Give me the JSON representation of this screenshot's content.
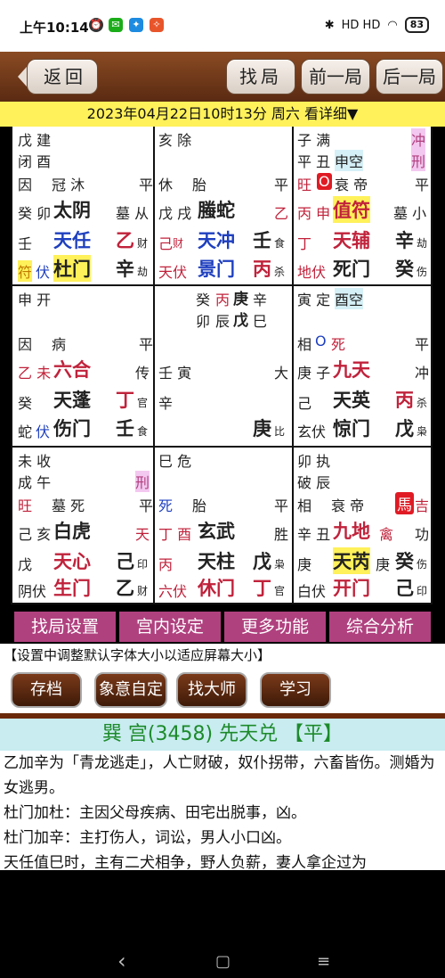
{
  "status": {
    "time": "上午10:14",
    "right": "HD HD",
    "battery": "83"
  },
  "topbar": {
    "back": "返回",
    "find": "找局",
    "prev": "前一局",
    "next": "后一局"
  },
  "date_line": "2023年04月22日10时13分 周六 看详细▼",
  "palaces": {
    "p1": {
      "l1": "戊 建",
      "l2": "闭 酉",
      "r1": "因",
      "r2": "冠 沐",
      "r3": "平",
      "r4a": "癸 卯",
      "r4b": "太阴",
      "r4c": "墓 从",
      "r5a": "壬",
      "r5b": "天任",
      "r5c": "乙",
      "r5d": "财",
      "r6a": "符",
      "r6b": "伏",
      "r6c": "杜门",
      "r6d": "辛",
      "r6e": "劫"
    },
    "p2": {
      "l1": "亥 除",
      "r1": "休",
      "r2": "胎",
      "r3": "平",
      "r4a": "戊 戌",
      "r4b": "螣蛇",
      "r4c": "乙",
      "r5a": "己",
      "r5b": "财",
      "r5c": "天冲",
      "r5d": "壬",
      "r5e": "食",
      "r6a": "天伏",
      "r6b": "景门",
      "r6c": "丙",
      "r6d": "杀"
    },
    "p3": {
      "l1": "子 满",
      "l2": "平 丑",
      "l2b": "申空",
      "tag1": "冲",
      "tag2": "刑",
      "r1a": "旺",
      "r1b": "O",
      "r1c": "衰 帝",
      "r1d": "平",
      "r4a": "丙 申",
      "r4b": "值符",
      "r4c": "墓 小",
      "r5a": "丁",
      "r5b": "天辅",
      "r5c": "辛",
      "r5d": "劫",
      "r6a": "地伏",
      "r6b": "死门",
      "r6c": "癸",
      "r6d": "伤"
    },
    "p4": {
      "l1": "申 开",
      "r1": "因",
      "r2": "病",
      "r3": "平",
      "r4a": "乙 未",
      "r4b": "六合",
      "r4c": "传",
      "r5a": "癸",
      "r5b": "天蓬",
      "r5c": "丁",
      "r5d": "官",
      "r6a": "蛇",
      "r6b": "伏",
      "r6c": "伤门",
      "r6d": "壬",
      "r6e": "食"
    },
    "p5": {
      "l1a": "癸",
      "l1b": "丙",
      "l1c": "庚",
      "l1d": "辛",
      "l2a": "卯",
      "l2b": "辰",
      "l2c": "戊",
      "l2d": "巳",
      "r1": "壬 寅",
      "r1b": "大",
      "r2": "辛",
      "r3a": "庚",
      "r3b": "比"
    },
    "p6": {
      "l1": "寅 定",
      "l1b": "酉空",
      "r1a": "相",
      "r1b": "O",
      "r1c": "死",
      "r1d": "平",
      "r4a": "庚 子",
      "r4b": "九天",
      "r4c": "冲",
      "r5a": "己",
      "r5b": "天英",
      "r5c": "丙",
      "r5d": "杀",
      "r6a": "玄伏",
      "r6b": "惊门",
      "r6c": "戊",
      "r6d": "枭"
    },
    "p7": {
      "l1": "未 收",
      "l2": "成 午",
      "tag": "刑",
      "r1a": "旺",
      "r1b": "墓 死",
      "r1c": "平",
      "r4a": "己 亥",
      "r4b": "白虎",
      "r4c": "天",
      "r5a": "戊",
      "r5b": "天心",
      "r5c": "己",
      "r5d": "印",
      "r6a": "阴伏",
      "r6b": "生门",
      "r6c": "乙",
      "r6d": "财"
    },
    "p8": {
      "l1": "巳 危",
      "r1a": "死",
      "r1b": "胎",
      "r1c": "平",
      "r4a": "丁 酉",
      "r4b": "玄武",
      "r4c": "胜",
      "r5a": "丙",
      "r5b": "天柱",
      "r5c": "戊",
      "r5d": "枭",
      "r6a": "六伏",
      "r6b": "休门",
      "r6c": "丁",
      "r6d": "官"
    },
    "p9": {
      "l1": "卯 执",
      "l2": "破 辰",
      "r1a": "相",
      "r1b": "衰 帝",
      "r1c": "馬",
      "r1d": "吉",
      "r4a": "辛 丑",
      "r4b": "九地",
      "r4c": "禽",
      "r4d": "功",
      "r5a": "庚",
      "r5b": "天芮",
      "r5c": "庚",
      "r5d": "癸",
      "r5e": "伤",
      "r6a": "白伏",
      "r6b": "开门",
      "r6c": "己",
      "r6d": "印"
    }
  },
  "purplebar": [
    "找局设置",
    "宫内设定",
    "更多功能",
    "综合分析"
  ],
  "hint": "【设置中调整默认字体大小以适应屏幕大小】",
  "buttons": [
    "存档",
    "象意自定",
    "找大师",
    "学习"
  ],
  "palace_title": "巽 宫(3458) 先天兑  【平】",
  "detail": [
    "乙加辛为「青龙逃走」，人亡财破，奴仆拐带，六畜皆伤。测婚为女逃男。",
    "杜门加杜：主因父母疾病、田宅出脱事，凶。",
    "杜门加辛：主打伤人，词讼，男人小口凶。",
    "天任值巳时，主有二犬相争，野人负薪，妻人拿企过为"
  ],
  "nav": {
    "back": "‹",
    "home": "▢",
    "menu": "≡"
  }
}
